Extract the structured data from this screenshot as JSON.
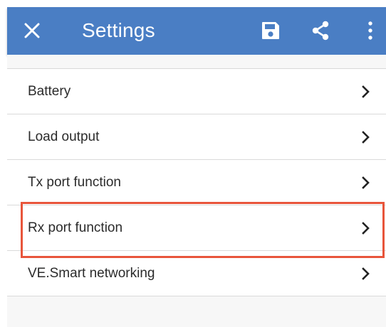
{
  "header": {
    "title": "Settings",
    "close_icon": "close-icon",
    "save_icon": "save-icon",
    "share_icon": "share-icon",
    "more_icon": "more-vertical-icon",
    "color": "#4a7ec4"
  },
  "settings": {
    "items": [
      {
        "label": "Battery"
      },
      {
        "label": "Load output"
      },
      {
        "label": "Tx port function"
      },
      {
        "label": "Rx port function"
      },
      {
        "label": "VE.Smart networking"
      }
    ]
  },
  "highlight": {
    "target": "Rx port function",
    "color": "#e8553b"
  }
}
